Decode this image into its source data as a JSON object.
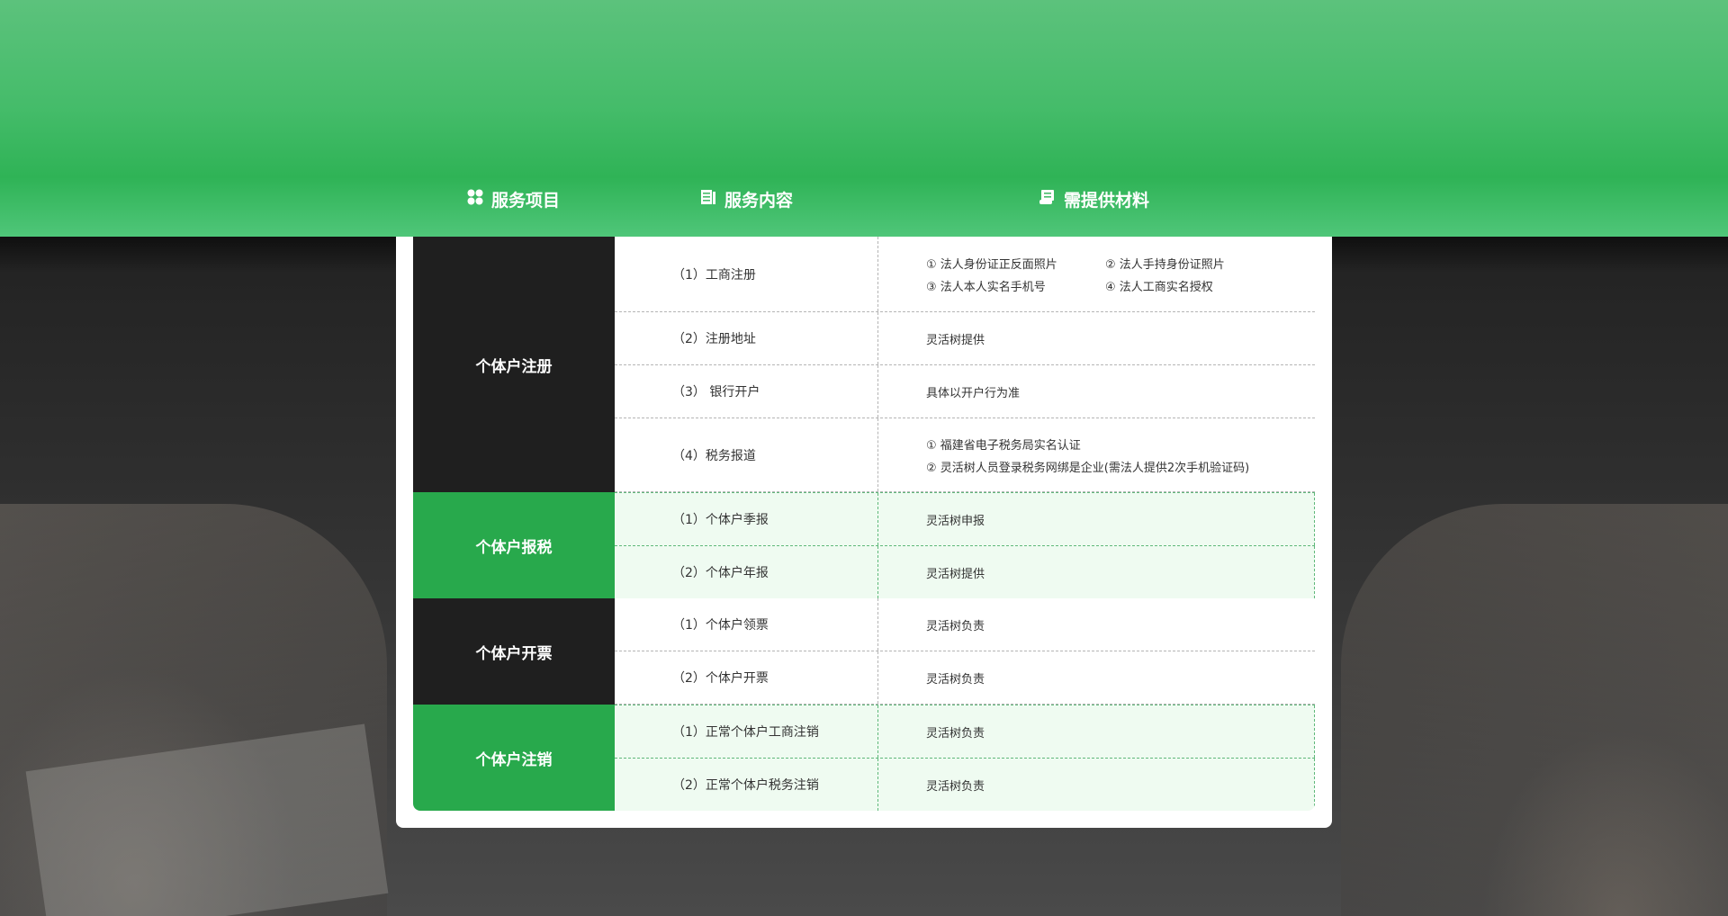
{
  "header": {
    "col1": {
      "label": "服务项目",
      "icon": "grid-icon"
    },
    "col2": {
      "label": "服务内容",
      "icon": "document-icon"
    },
    "col3": {
      "label": "需提供材料",
      "icon": "scroll-icon"
    }
  },
  "groups": [
    {
      "label": "个体户注册",
      "rows": [
        {
          "content": "（1）工商注册",
          "materials": [
            "① 法人身份证正反面照片",
            "② 法人手持身份证照片",
            "③ 法人本人实名手机号",
            "④ 法人工商实名授权"
          ]
        },
        {
          "content": "（2）注册地址",
          "materials": [
            "灵活树提供"
          ]
        },
        {
          "content": "（3） 银行开户",
          "materials": [
            "具体以开户行为准"
          ]
        },
        {
          "content": "（4）税务报道",
          "materials": [
            "① 福建省电子税务局实名认证",
            "② 灵活树人员登录税务网绑是企业(需法人提供2次手机验证码)"
          ]
        }
      ]
    },
    {
      "label": "个体户报税",
      "rows": [
        {
          "content": "（1）个体户季报",
          "materials": [
            "灵活树申报"
          ]
        },
        {
          "content": "（2）个体户年报",
          "materials": [
            "灵活树提供"
          ]
        }
      ]
    },
    {
      "label": "个体户开票",
      "rows": [
        {
          "content": "（1）个体户领票",
          "materials": [
            "灵活树负责"
          ]
        },
        {
          "content": "（2）个体户开票",
          "materials": [
            "灵活树负责"
          ]
        }
      ]
    },
    {
      "label": "个体户注销",
      "rows": [
        {
          "content": "（1）正常个体户工商注销",
          "materials": [
            "灵活树负责"
          ]
        },
        {
          "content": "（2）正常个体户税务注销",
          "materials": [
            "灵活树负责"
          ]
        }
      ]
    }
  ],
  "colors": {
    "green": "#28a94c",
    "dark": "#1f1f1f",
    "band": "#3fba63"
  }
}
